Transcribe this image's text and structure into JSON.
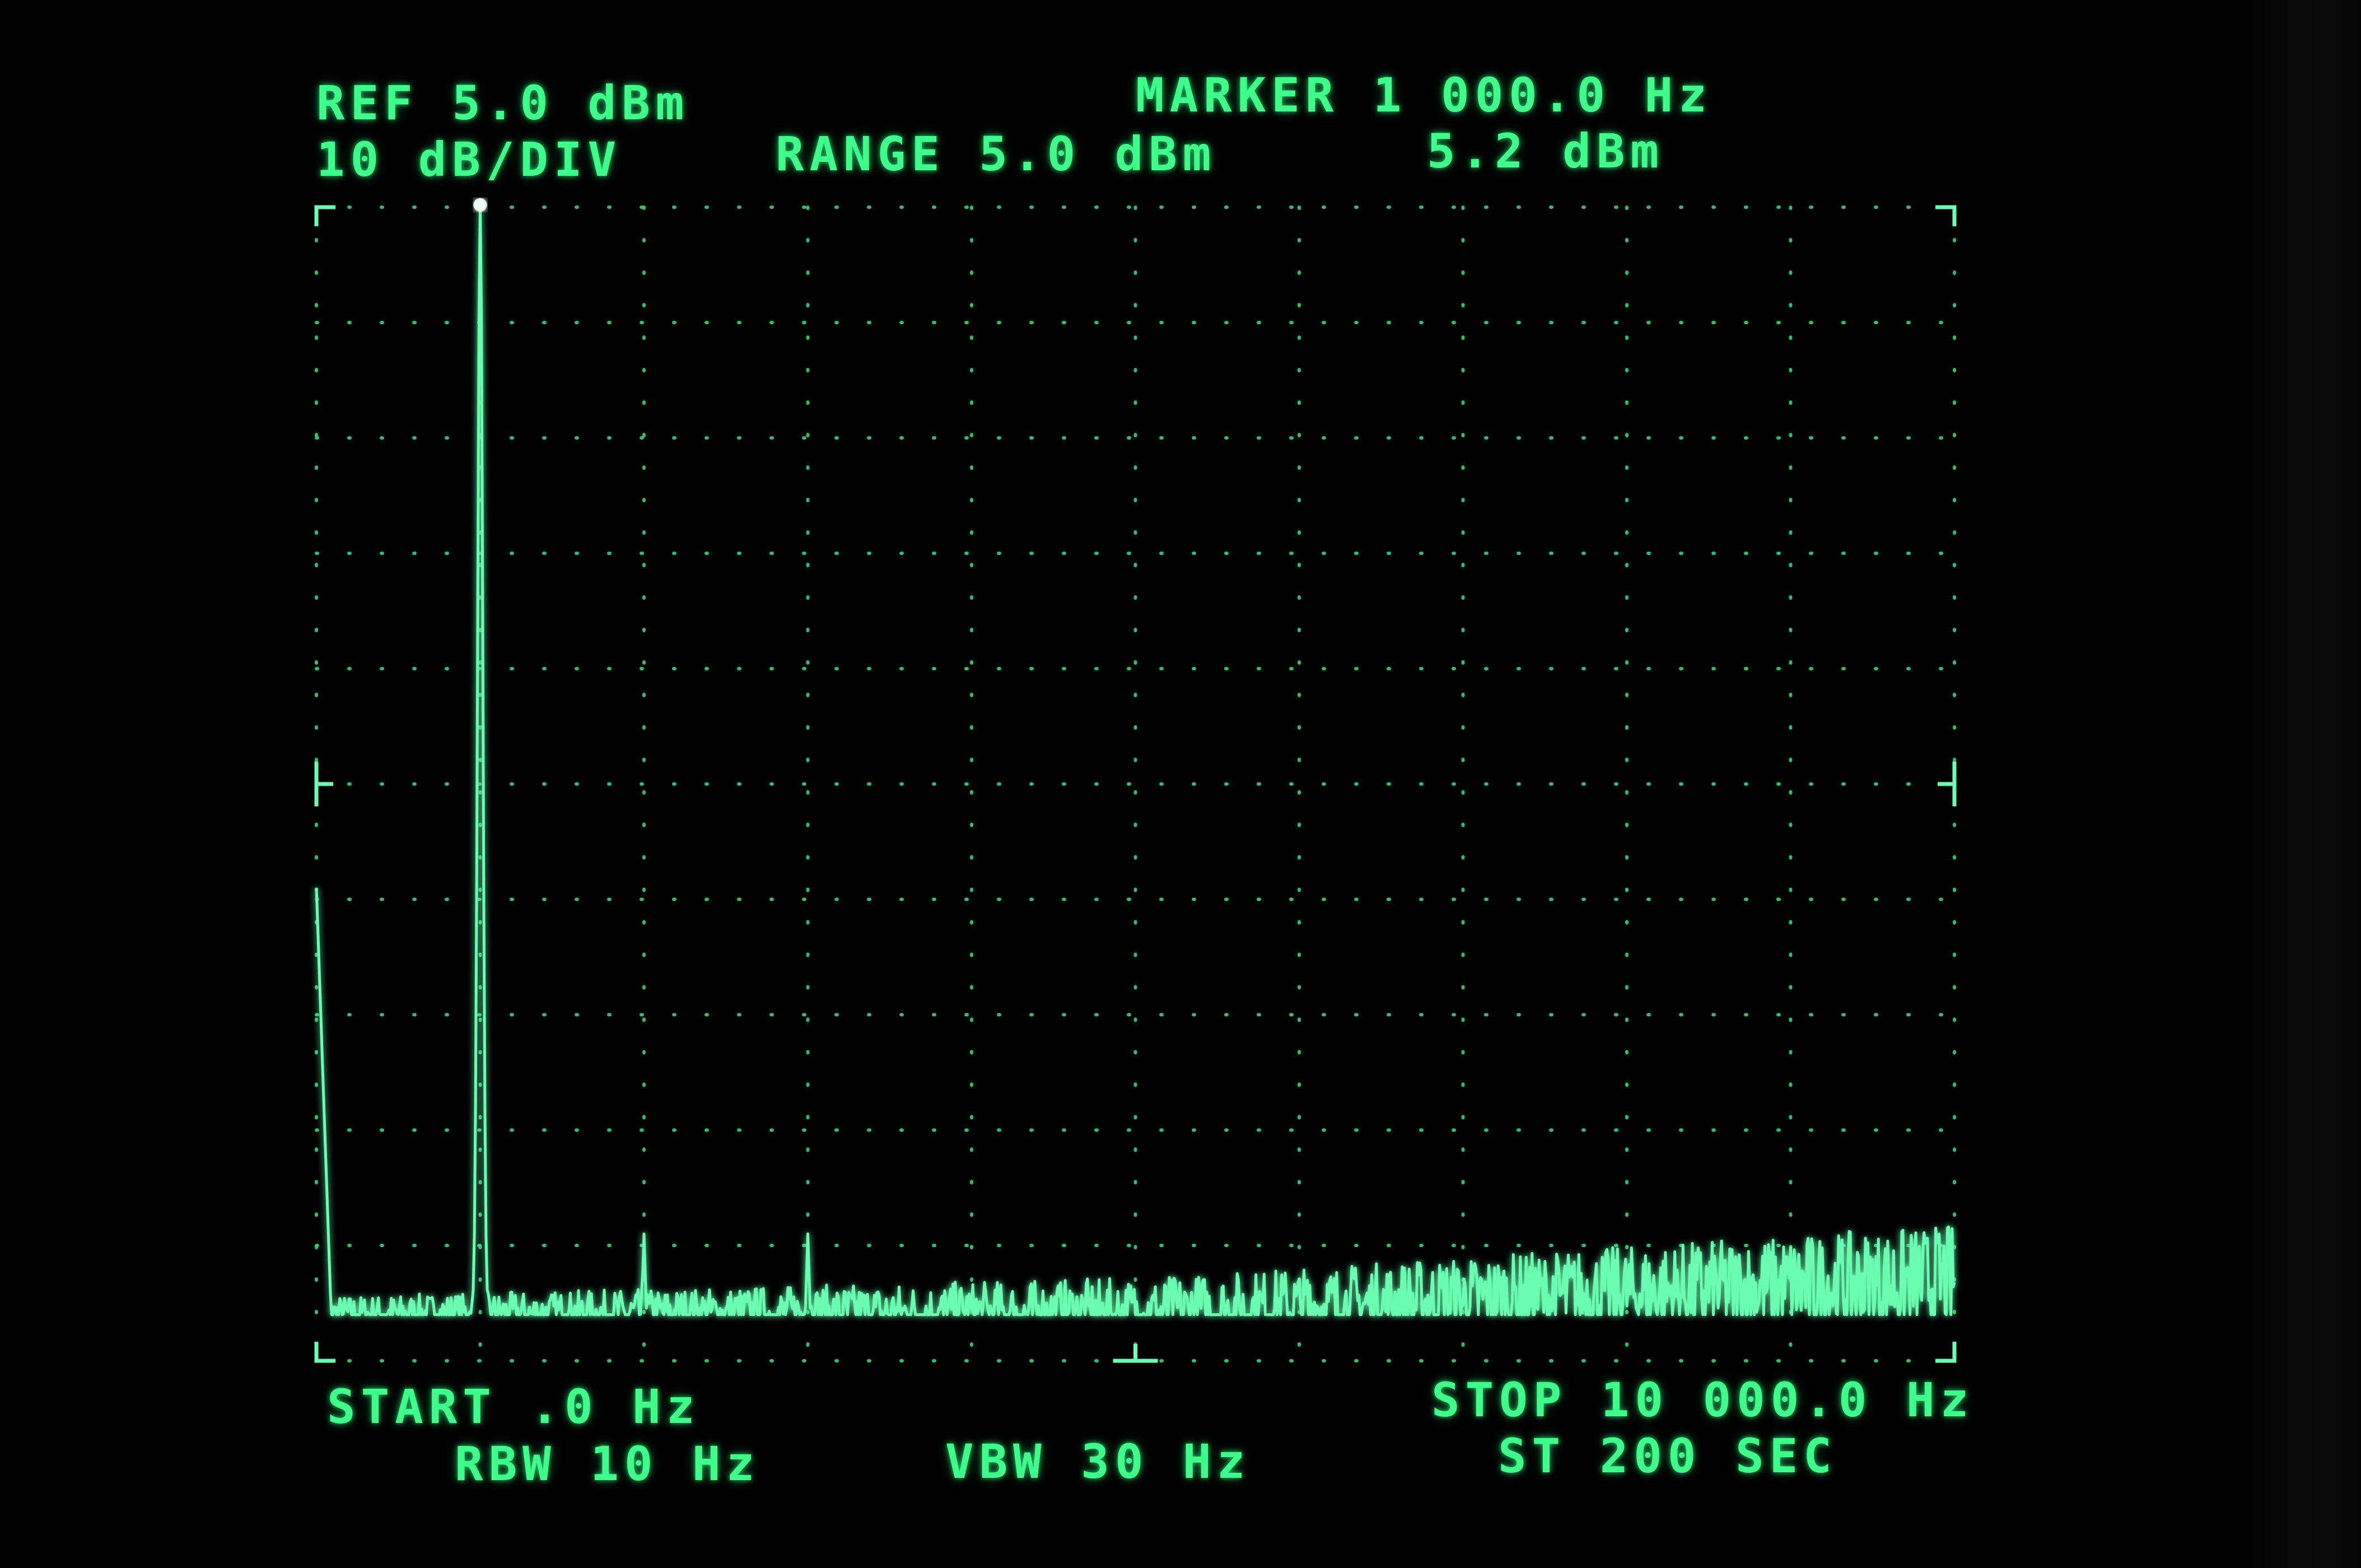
{
  "header": {
    "ref": "REF 5.0 dBm",
    "scale": "10 dB/DIV",
    "range": "RANGE 5.0 dBm",
    "marker": "MARKER 1 000.0 Hz",
    "marker_level": "5.2 dBm"
  },
  "footer": {
    "start": "START .0 Hz",
    "stop": "STOP 10 000.0 Hz",
    "rbw": "RBW 10 Hz",
    "vbw": "VBW 30 Hz",
    "sweep_time": "ST 200 SEC"
  },
  "colors": {
    "trace": "#6bffb0",
    "text": "#3dff8a",
    "grid": "#2fd774",
    "background": "#000000"
  },
  "chart_data": {
    "type": "line",
    "xlim": [
      0,
      10000
    ],
    "ylim": [
      -95,
      5
    ],
    "x_divisions": 10,
    "y_divisions": 10,
    "grid": true,
    "marker": {
      "x": 1000,
      "y": 5.2
    },
    "noise_floor": {
      "x": [
        0,
        5000,
        10000
      ],
      "y": [
        -91,
        -91,
        -88
      ]
    },
    "peaks": [
      {
        "x": 0,
        "y": -54
      },
      {
        "x": 1000,
        "y": 5.2
      },
      {
        "x": 2000,
        "y": -84
      },
      {
        "x": 3000,
        "y": -84
      }
    ]
  }
}
